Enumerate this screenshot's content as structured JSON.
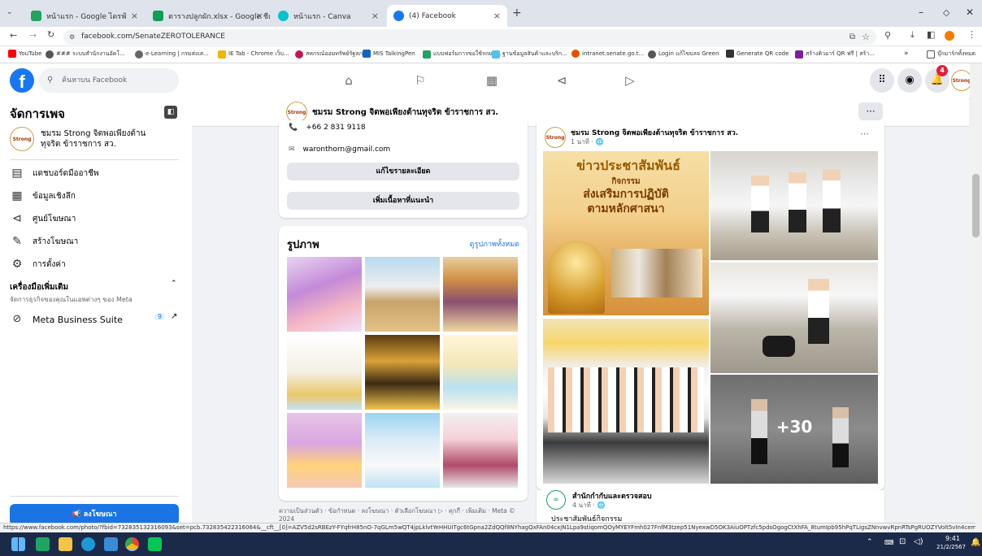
{
  "browser": {
    "tabs": [
      {
        "label": "หน้าแรก - Google ไดรฟ์",
        "color": "#1fa463"
      },
      {
        "label": "ตารางปลูกผัก.xlsx - Google ชีต",
        "color": "#0f9d58"
      },
      {
        "label": "หน้าแรก - Canva",
        "color": "#00c4cc"
      },
      {
        "label": "(4) Facebook",
        "color": "#1877f2"
      }
    ],
    "url": "facebook.com/SenateZEROTOLERANCE",
    "bookmarks": [
      {
        "label": "YouTube",
        "color": "#ff0000"
      },
      {
        "label": "### ระบบสำนักงานอัตโ...",
        "color": "#555"
      },
      {
        "label": "e-Learning | กรมส่งเส...",
        "color": "#666"
      },
      {
        "label": "IE Tab - Chrome เว็บ...",
        "color": "#f4b400"
      },
      {
        "label": "สหกรณ์ออมทรัพย์รัฐสภา",
        "color": "#c2185b"
      },
      {
        "label": "MIS TalkingPen",
        "color": "#1565c0"
      },
      {
        "label": "แบบฟอร์มการขอใช้รถยน...",
        "color": "#1fa463"
      },
      {
        "label": "ฐานข้อมูลสินค้าและบริก...",
        "color": "#4fc3f7"
      },
      {
        "label": "intranet.senate.go.t...",
        "color": "#e65100"
      },
      {
        "label": "Login แก้ไขบลจ Green",
        "color": "#555"
      },
      {
        "label": "Generate QR code",
        "color": "#333"
      },
      {
        "label": "สร้างคิวอาร์ QR ฟรี | สร้า...",
        "color": "#7b1fa2"
      },
      {
        "label": "บุ๊กมาร์กทั้งหมด",
        "color": "#555"
      }
    ],
    "status_url": "https://www.facebook.com/photo/?fbid=732835132316093&set=pcb.732835422316064&__cft__[0]=AZV5d2sRBEzY-FYqfrH85nO-7qGLm5wQT4jpLklvtYeHHUiTgc6tGpna2ZdQQf8NYhagQxFAn04cxjN1Lpa9stiqomQOyMYEYFmh027FnfM3tzep51NyexwD5OK3AiuOPTzfc5pdsOgogCtXhFA_8tumIpb95hPqTLigsZNnvwvRpnRTsPgRUOZYVolt5vIn4cem64-wqnLT7..."
  },
  "fb": {
    "search_placeholder": "ค้นหาบน Facebook",
    "notif_count": "4"
  },
  "sidebar": {
    "title": "จัดการเพจ",
    "page_name": "ชมรม Strong จิตพอเพียงต้านทุจริต ข้าราชการ สว.",
    "items": [
      {
        "label": "แดชบอร์ดมืออาชีพ",
        "icon": "dashboard-icon"
      },
      {
        "label": "ข้อมูลเชิงลึก",
        "icon": "insights-icon"
      },
      {
        "label": "ศูนย์โฆษณา",
        "icon": "megaphone-icon"
      },
      {
        "label": "สร้างโฆษณา",
        "icon": "edit-icon"
      },
      {
        "label": "การตั้งค่า",
        "icon": "gear-icon"
      }
    ],
    "more_tools_title": "เครื่องมือเพิ่มเติม",
    "more_tools_sub": "จัดการธุรกิจของคุณในแอพต่างๆ ของ Meta",
    "meta_suite": "Meta Business Suite",
    "meta_suite_count": "9",
    "ad_button": "ลงโฆษณา"
  },
  "page_bar": {
    "name": "ชมรม Strong จิตพอเพียงต้านทุจริต ข้าราชการ สว."
  },
  "about_card": {
    "phone": "+66 2 831 9118",
    "email": "waronthorn@gmail.com",
    "edit_details": "แก้ไขรายละเอียด",
    "add_featured": "เพิ่มเนื้อหาที่แนะนำ"
  },
  "photos_card": {
    "title": "รูปภาพ",
    "see_all": "ดูรูปภาพทั้งหมด"
  },
  "footer_text": "ความเป็นส่วนตัว · ข้อกำหนด · ลงโฆษณา · ตัวเลือกโฆษณา ▷ · คุกกี้ · เพิ่มเติม · Meta © 2024",
  "post": {
    "author": "ชมรม Strong จิตพอเพียงต้านทุจริต ข้าราชการ สว.",
    "time": "1 นาที · 🌐",
    "poster_title": "ข่าวประชาสัมพันธ์",
    "poster_sub1": "กิจกรรม",
    "poster_sub2": "ส่งเสริมการปฏิบัติ",
    "poster_sub3": "ตามหลักศาสนา",
    "more_count": "+30"
  },
  "post2": {
    "author": "สำนักกำกับและตรวจสอบ",
    "time": "4 นาที · 🌐",
    "text": "ประชาสัมพันธ์กิจกรรม"
  },
  "taskbar": {
    "time": "9:41",
    "date": "21/2/2567"
  }
}
